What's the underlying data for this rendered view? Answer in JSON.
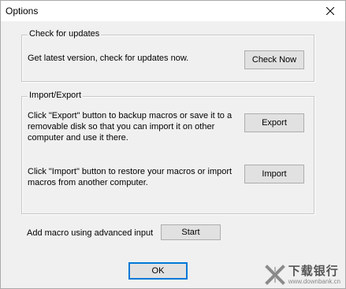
{
  "window": {
    "title": "Options"
  },
  "updates": {
    "group_title": "Check for updates",
    "description": "Get latest version, check for updates now.",
    "button_label": "Check Now"
  },
  "import_export": {
    "group_title": "Import/Export",
    "export_description": "Click \"Export\" button to backup macros or save it to a removable disk so that you can import it on other computer and use it there.",
    "export_button_label": "Export",
    "import_description": "Click \"Import\" button to restore your macros or import macros from another computer.",
    "import_button_label": "Import"
  },
  "advanced": {
    "label": "Add macro using advanced input",
    "button_label": "Start"
  },
  "footer": {
    "ok_label": "OK"
  },
  "watermark": {
    "main_text": "下载银行",
    "sub_text": "www.downbank.cn"
  },
  "icons": {
    "close": "close-icon",
    "watermark_logo": "x-logo-icon"
  }
}
